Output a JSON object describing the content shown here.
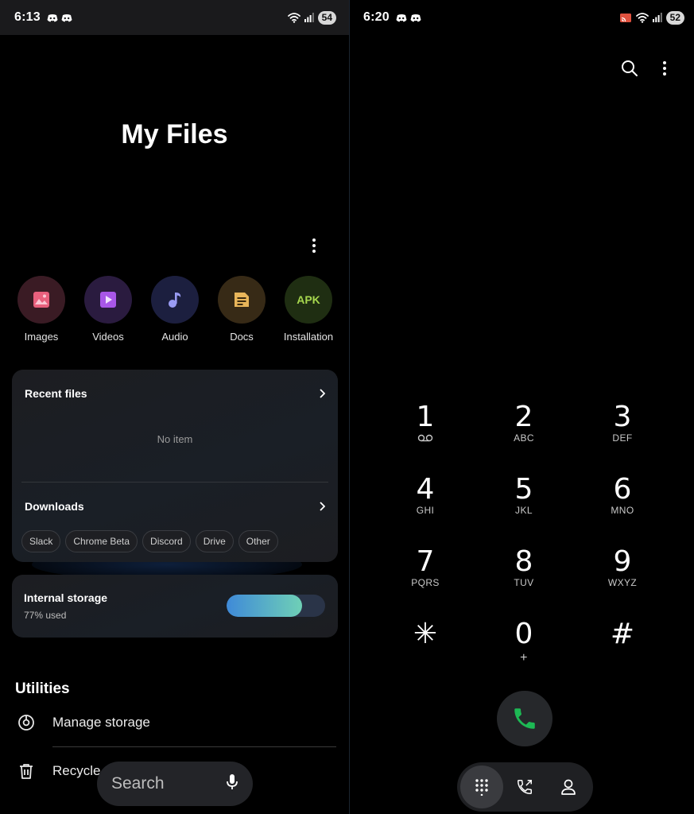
{
  "colors": {
    "background": "#000000",
    "card": "#1c1d21",
    "call_green": "#1db954",
    "apk_green": "#a6d64e",
    "storage_fill": "#5cc0c4"
  },
  "files": {
    "status": {
      "time": "6:13",
      "battery": "54"
    },
    "title": "My Files",
    "categories": [
      {
        "label": "Images",
        "icon": "image-icon",
        "bg": "#3a1b24",
        "fg": "#e8607d"
      },
      {
        "label": "Videos",
        "icon": "video-icon",
        "bg": "#2a1b3f",
        "fg": "#a857e8"
      },
      {
        "label": "Audio",
        "icon": "music-icon",
        "bg": "#1c1f3f",
        "fg": "#8a8cf0"
      },
      {
        "label": "Docs",
        "icon": "document-icon",
        "bg": "#372a16",
        "fg": "#e8b55a"
      },
      {
        "label": "Installation",
        "icon_text": "APK",
        "bg": "#1f2e12"
      }
    ],
    "recent": {
      "title": "Recent files",
      "empty": "No item"
    },
    "downloads": {
      "title": "Downloads",
      "chips": [
        "Slack",
        "Chrome Beta",
        "Discord",
        "Drive",
        "Other"
      ]
    },
    "storage": {
      "title": "Internal storage",
      "used": "77% used",
      "fraction": 0.77
    },
    "utilities": {
      "title": "Utilities",
      "manage_storage": "Manage storage",
      "recycle_bin": "Recycle"
    },
    "search": {
      "label": "Search"
    }
  },
  "dialer": {
    "status": {
      "time": "6:20",
      "battery": "52"
    },
    "keys": [
      {
        "digit": "1",
        "sub": "",
        "voicemail": true
      },
      {
        "digit": "2",
        "sub": "ABC"
      },
      {
        "digit": "3",
        "sub": "DEF"
      },
      {
        "digit": "4",
        "sub": "GHI"
      },
      {
        "digit": "5",
        "sub": "JKL"
      },
      {
        "digit": "6",
        "sub": "MNO"
      },
      {
        "digit": "7",
        "sub": "PQRS"
      },
      {
        "digit": "8",
        "sub": "TUV"
      },
      {
        "digit": "9",
        "sub": "WXYZ"
      },
      {
        "digit": "✳",
        "sub": ""
      },
      {
        "digit": "0",
        "sub": "+"
      },
      {
        "digit": "#",
        "sub": ""
      }
    ],
    "nav": [
      "keypad-icon",
      "recents-icon",
      "contacts-icon"
    ]
  }
}
